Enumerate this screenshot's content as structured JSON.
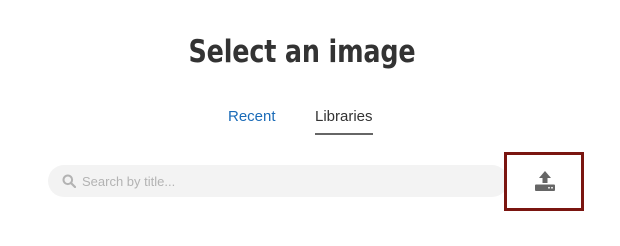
{
  "dialog": {
    "title": "Select an image"
  },
  "tabs": [
    {
      "label": "Recent",
      "active": false
    },
    {
      "label": "Libraries",
      "active": true
    }
  ],
  "search": {
    "placeholder": "Search by title...",
    "value": "",
    "icon": "search-icon"
  },
  "upload": {
    "icon": "upload-icon"
  },
  "colors": {
    "title": "#333333",
    "link": "#1a6bb8",
    "active_tab_underline": "#666666",
    "search_background": "#f3f3f3",
    "upload_border": "#7a1510",
    "icon": "#666666"
  }
}
